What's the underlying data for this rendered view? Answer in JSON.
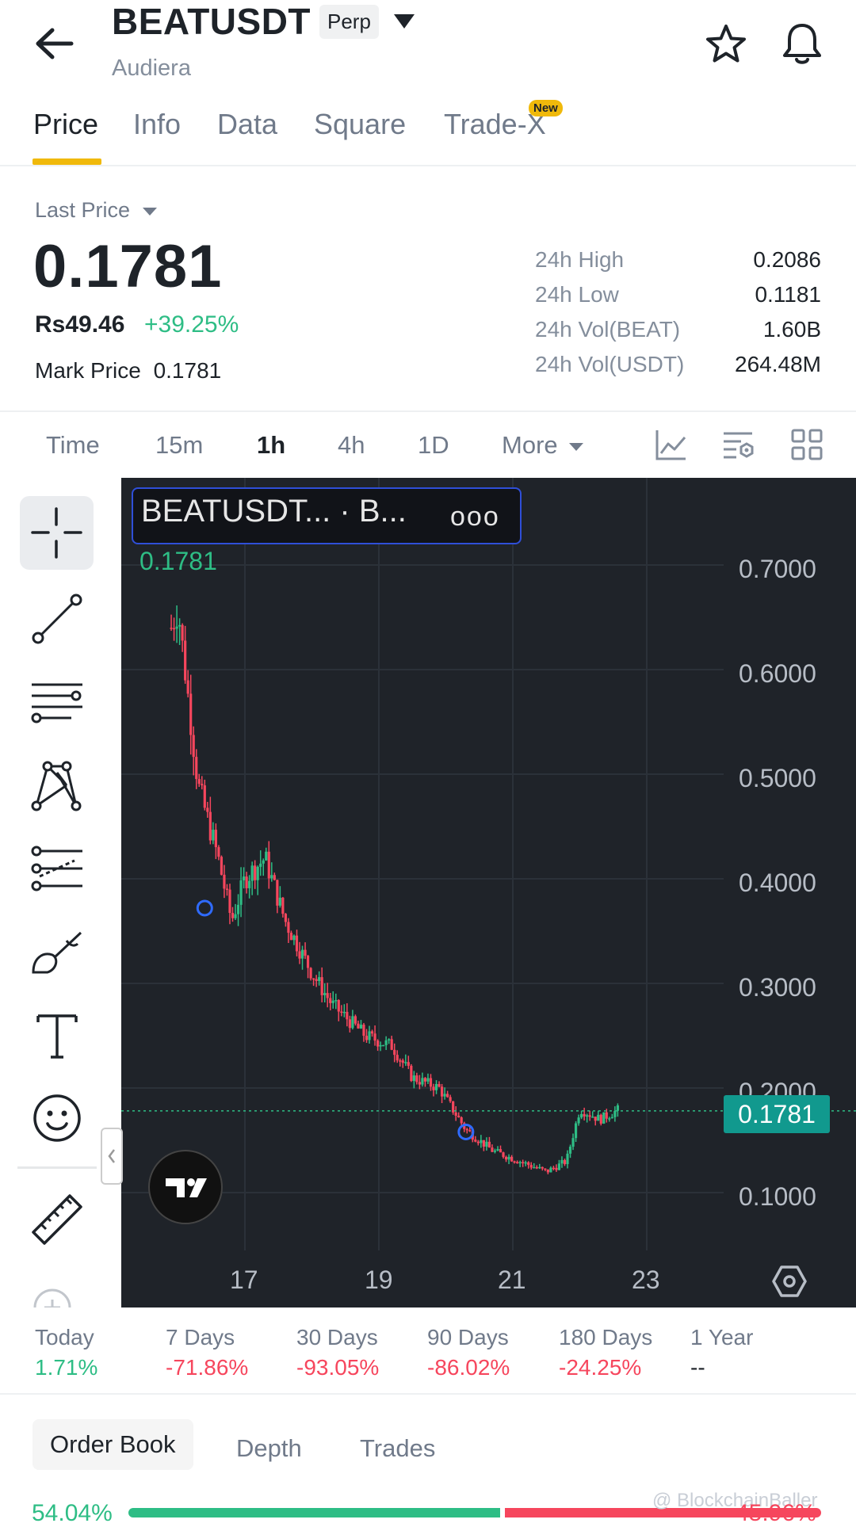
{
  "header": {
    "symbol": "BEATUSDT",
    "contract_type": "Perp",
    "subtitle": "Audiera",
    "icons": [
      "back-arrow-icon",
      "caret-down-icon",
      "star-icon",
      "bell-icon"
    ]
  },
  "tabs": [
    {
      "label": "Price",
      "active": true
    },
    {
      "label": "Info",
      "active": false
    },
    {
      "label": "Data",
      "active": false
    },
    {
      "label": "Square",
      "active": false
    },
    {
      "label": "Trade-X",
      "active": false,
      "badge": "New"
    }
  ],
  "price": {
    "selector_label": "Last Price",
    "last_price": "0.1781",
    "fiat_value": "Rs49.46",
    "change_pct": "+39.25%",
    "mark_label": "Mark Price",
    "mark_value": "0.1781"
  },
  "stats": [
    {
      "label": "24h High",
      "value": "0.2086"
    },
    {
      "label": "24h Low",
      "value": "0.1181"
    },
    {
      "label": "24h Vol(BEAT)",
      "value": "1.60B"
    },
    {
      "label": "24h Vol(USDT)",
      "value": "264.48M"
    }
  ],
  "intervals": [
    {
      "label": "Time",
      "active": false
    },
    {
      "label": "15m",
      "active": false
    },
    {
      "label": "1h",
      "active": true
    },
    {
      "label": "4h",
      "active": false
    },
    {
      "label": "1D",
      "active": false
    },
    {
      "label": "More",
      "active": false
    }
  ],
  "chart": {
    "legend_symbol": "BEATUSDT... · B...",
    "legend_menu": "ooo",
    "last_label": "0.1781",
    "price_tag": "0.1781",
    "y_ticks": [
      "0.7000",
      "0.6000",
      "0.5000",
      "0.4000",
      "0.3000",
      "0.2000",
      "0.1000"
    ],
    "x_ticks": [
      "17",
      "19",
      "21",
      "23"
    ],
    "up_color": "#2ebd85",
    "down_color": "#f6465d"
  },
  "chart_data": {
    "type": "candlestick",
    "interval": "1h",
    "x_ticks": [
      "17",
      "19",
      "21",
      "23"
    ],
    "ylim": [
      0.1,
      0.7
    ],
    "last_price": 0.1781,
    "approx_close_path": {
      "x_day": [
        15.9,
        16.0,
        16.3,
        16.6,
        16.8,
        17.0,
        17.3,
        17.6,
        18.0,
        18.3,
        18.8,
        19.2,
        19.5,
        19.9,
        20.3,
        20.7,
        21.1,
        21.5,
        21.8,
        22.0,
        22.3,
        22.6
      ],
      "price": [
        0.64,
        0.66,
        0.49,
        0.42,
        0.36,
        0.4,
        0.42,
        0.36,
        0.31,
        0.28,
        0.25,
        0.24,
        0.21,
        0.2,
        0.16,
        0.14,
        0.13,
        0.12,
        0.13,
        0.18,
        0.17,
        0.18
      ]
    }
  },
  "performance": [
    {
      "label": "Today",
      "value": "1.71%",
      "color": "#2ebd85"
    },
    {
      "label": "7 Days",
      "value": "-71.86%",
      "color": "#f6465d"
    },
    {
      "label": "30 Days",
      "value": "-93.05%",
      "color": "#f6465d"
    },
    {
      "label": "90 Days",
      "value": "-86.02%",
      "color": "#f6465d"
    },
    {
      "label": "180 Days",
      "value": "-24.25%",
      "color": "#f6465d"
    },
    {
      "label": "1 Year",
      "value": "--",
      "color": "#1e2329"
    }
  ],
  "bottom_tabs": [
    {
      "label": "Order Book",
      "active": true
    },
    {
      "label": "Depth",
      "active": false
    },
    {
      "label": "Trades",
      "active": false
    }
  ],
  "order_book": {
    "buy_pct": "54.04%",
    "sell_pct": "45.96%",
    "buy_ratio": 0.5404
  },
  "watermark": "@ BlockchainBaller"
}
